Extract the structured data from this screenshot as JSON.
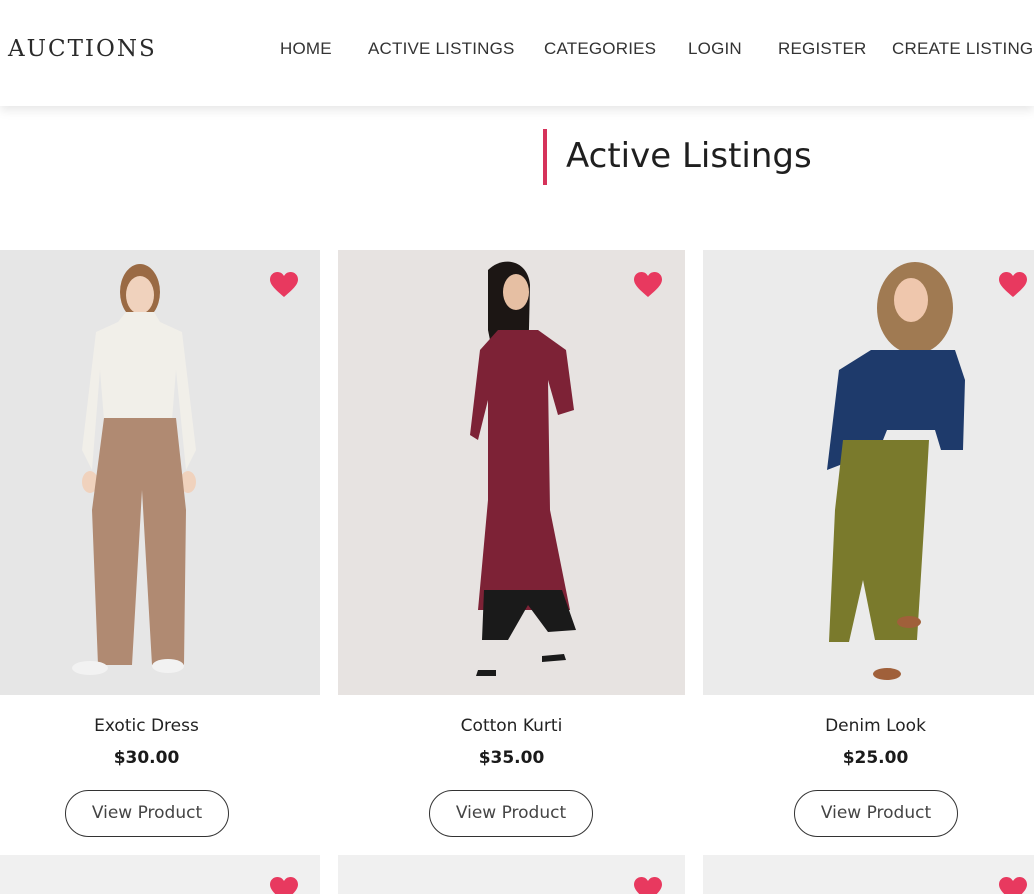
{
  "brand": "AUCTIONS",
  "nav": [
    {
      "label": "HOME"
    },
    {
      "label": "ACTIVE LISTINGS"
    },
    {
      "label": "CATEGORIES"
    },
    {
      "label": "LOGIN"
    },
    {
      "label": "REGISTER"
    },
    {
      "label": "CREATE LISTING"
    }
  ],
  "page_title": "Active Listings",
  "colors": {
    "accent": "#d6325a",
    "heart": "#e8395f",
    "card_bg": "#ececec"
  },
  "listings": [
    {
      "name": "Exotic Dress",
      "price": "$30.00",
      "button": "View Product",
      "image": "woman in white turtleneck and tan trousers"
    },
    {
      "name": "Cotton Kurti",
      "price": "$35.00",
      "button": "View Product",
      "image": "woman in maroon kurti and black pants"
    },
    {
      "name": "Denim Look",
      "price": "$25.00",
      "button": "View Product",
      "image": "woman in denim jacket and olive pants"
    }
  ]
}
